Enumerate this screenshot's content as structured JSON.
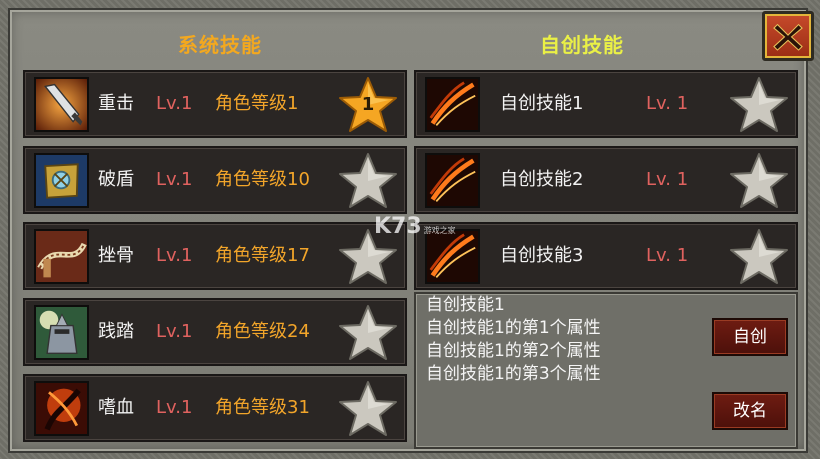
{
  "titles": {
    "system": "系统技能",
    "custom": "自创技能"
  },
  "close_icon": "close-x-icon",
  "system_skills": [
    {
      "name": "重击",
      "level": "Lv.1",
      "requirement": "角色等级1",
      "star_value": "1",
      "star_active": true,
      "icon": "sword-icon"
    },
    {
      "name": "破盾",
      "level": "Lv.1",
      "requirement": "角色等级10",
      "star_value": "",
      "star_active": false,
      "icon": "shield-break-icon"
    },
    {
      "name": "挫骨",
      "level": "Lv.1",
      "requirement": "角色等级17",
      "star_value": "",
      "star_active": false,
      "icon": "whip-icon"
    },
    {
      "name": "践踏",
      "level": "Lv.1",
      "requirement": "角色等级24",
      "star_value": "",
      "star_active": false,
      "icon": "knight-stomp-icon"
    },
    {
      "name": "嗜血",
      "level": "Lv.1",
      "requirement": "角色等级31",
      "star_value": "",
      "star_active": false,
      "icon": "bloodlust-icon"
    }
  ],
  "custom_skills": [
    {
      "name": "自创技能1",
      "level": "Lv. 1",
      "icon": "flame-slash-icon"
    },
    {
      "name": "自创技能2",
      "level": "Lv. 1",
      "icon": "flame-slash-icon"
    },
    {
      "name": "自创技能3",
      "level": "Lv. 1",
      "icon": "flame-slash-icon"
    }
  ],
  "description": {
    "lines": [
      "自创技能1",
      "自创技能1的第1个属性",
      "自创技能1的第2个属性",
      "自创技能1的第3个属性"
    ]
  },
  "buttons": {
    "create": "自创",
    "rename": "改名"
  },
  "watermark": {
    "brand": "K73",
    "sub": "游戏之家"
  },
  "colors": {
    "system_title": "#f3a81f",
    "custom_title": "#eaf046",
    "level": "#e0625f",
    "requirement": "#f2a52a",
    "star_gold": "#f5a623",
    "star_grey": "#c9c6bd"
  }
}
